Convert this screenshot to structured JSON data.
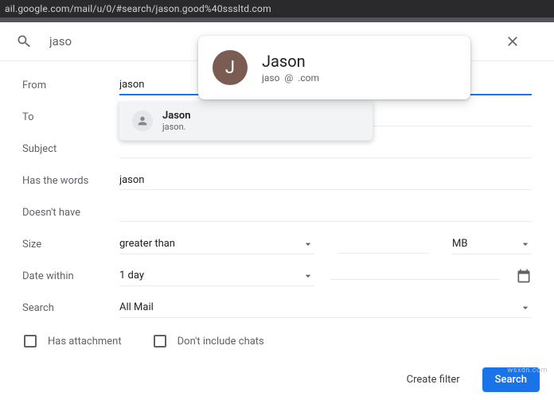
{
  "url": "ail.google.com/mail/u/0/#search/jason.good%40sssltd.com",
  "search": {
    "value": "jaso"
  },
  "card": {
    "initial": "J",
    "name": "Jason",
    "email_user": "jaso",
    "email_at": "@",
    "email_domain": ".com"
  },
  "autocomplete": {
    "name": "Jason",
    "email": "jason."
  },
  "form": {
    "from_label": "From",
    "from_value": "jason",
    "to_label": "To",
    "to_value": "",
    "subject_label": "Subject",
    "subject_value": "",
    "words_label": "Has the words",
    "words_value": "jason",
    "doesnt_label": "Doesn't have",
    "doesnt_value": "",
    "size_label": "Size",
    "size_op": "greater than",
    "size_val": "",
    "size_unit": "MB",
    "date_label": "Date within",
    "date_range": "1 day",
    "search_label": "Search",
    "search_scope": "All Mail",
    "check_attach": "Has attachment",
    "check_chats": "Don't include chats"
  },
  "actions": {
    "create_filter": "Create filter",
    "search": "Search"
  },
  "watermark": "wsxdn.com"
}
